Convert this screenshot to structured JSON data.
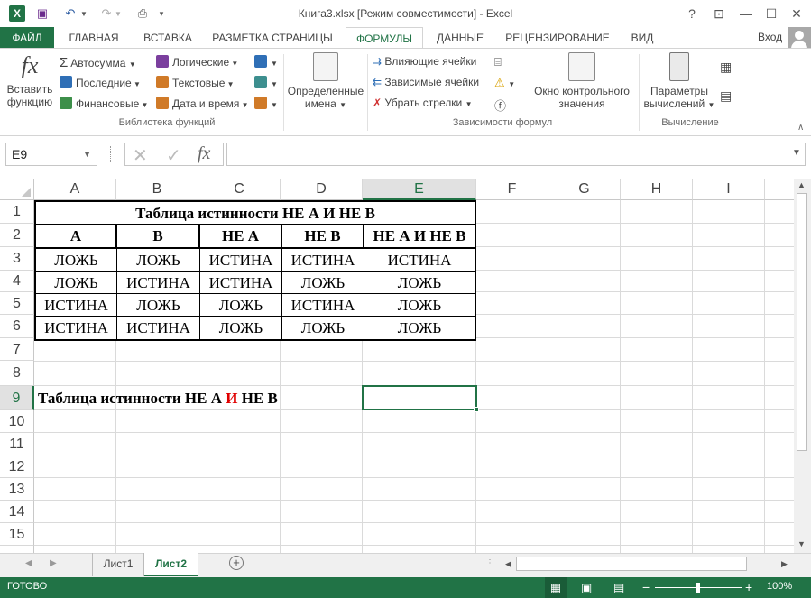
{
  "window": {
    "title": "Книга3.xlsx  [Режим совместимости] - Excel",
    "help": "?",
    "minimize": "—",
    "close": "✕"
  },
  "tabs": [
    "ФАЙЛ",
    "ГЛАВНАЯ",
    "ВСТАВКА",
    "РАЗМЕТКА СТРАНИЦЫ",
    "ФОРМУЛЫ",
    "ДАННЫЕ",
    "РЕЦЕНЗИРОВАНИЕ",
    "ВИД"
  ],
  "signin": "Вход",
  "ribbon": {
    "insert_function": [
      "Вставить",
      "функцию"
    ],
    "autosum": "Автосумма",
    "recent": "Последние",
    "financial": "Финансовые",
    "logical": "Логические",
    "text": "Текстовые",
    "datetime": "Дата и время",
    "library_label": "Библиотека функций",
    "defined_names": [
      "Определенные",
      "имена"
    ],
    "trace_precedents": "Влияющие ячейки",
    "trace_dependents": "Зависимые ячейки",
    "remove_arrows": "Убрать стрелки",
    "audit_label": "Зависимости формул",
    "watch_window": [
      "Окно контрольного",
      "значения"
    ],
    "calc_options": [
      "Параметры",
      "вычислений"
    ],
    "calc_label": "Вычисление"
  },
  "formula_bar": {
    "namebox": "E9",
    "fx": "fx",
    "value": ""
  },
  "columns": [
    "A",
    "B",
    "C",
    "D",
    "E",
    "F",
    "G",
    "H",
    "I"
  ],
  "rows": [
    "1",
    "2",
    "3",
    "4",
    "5",
    "6",
    "7",
    "8",
    "9",
    "10",
    "11",
    "12",
    "13",
    "14",
    "15"
  ],
  "table": {
    "title": "Таблица истинности НЕ А И НЕ В",
    "headers": [
      "A",
      "B",
      "НЕ А",
      "НЕ В",
      "НЕ А И НЕ В"
    ],
    "data": [
      [
        "ЛОЖЬ",
        "ЛОЖЬ",
        "ИСТИНА",
        "ИСТИНА",
        "ИСТИНА"
      ],
      [
        "ЛОЖЬ",
        "ИСТИНА",
        "ИСТИНА",
        "ЛОЖЬ",
        "ЛОЖЬ"
      ],
      [
        "ИСТИНА",
        "ЛОЖЬ",
        "ЛОЖЬ",
        "ИСТИНА",
        "ЛОЖЬ"
      ],
      [
        "ИСТИНА",
        "ИСТИНА",
        "ЛОЖЬ",
        "ЛОЖЬ",
        "ЛОЖЬ"
      ]
    ]
  },
  "row9": {
    "part1": "Таблица истинности НЕ А ",
    "part2": "И",
    "part3": " НЕ В",
    "accent_color": "#e00000"
  },
  "sheets": [
    "Лист1",
    "Лист2"
  ],
  "active_sheet": "Лист2",
  "status": {
    "ready": "ГОТОВО",
    "zoom": "100%"
  },
  "colors": {
    "excel_green": "#217346"
  }
}
